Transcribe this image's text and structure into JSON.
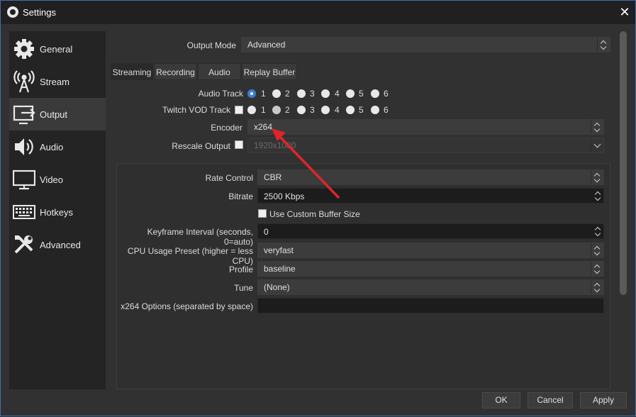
{
  "window": {
    "title": "Settings",
    "close_glyph": "✕"
  },
  "sidebar": {
    "items": [
      {
        "label": "General",
        "icon": "gear-icon"
      },
      {
        "label": "Stream",
        "icon": "broadcast-icon"
      },
      {
        "label": "Output",
        "icon": "output-icon",
        "active": true
      },
      {
        "label": "Audio",
        "icon": "speaker-icon"
      },
      {
        "label": "Video",
        "icon": "monitor-icon"
      },
      {
        "label": "Hotkeys",
        "icon": "keyboard-icon"
      },
      {
        "label": "Advanced",
        "icon": "tools-icon"
      }
    ]
  },
  "output": {
    "mode_label": "Output Mode",
    "mode_value": "Advanced",
    "tabs": [
      "Streaming",
      "Recording",
      "Audio",
      "Replay Buffer"
    ],
    "active_tab": "Streaming",
    "audio_track_label": "Audio Track",
    "twitch_vod_label": "Twitch VOD Track",
    "track_numbers": [
      "1",
      "2",
      "3",
      "4",
      "5",
      "6"
    ],
    "encoder_label": "Encoder",
    "encoder_value": "x264",
    "rescale_label": "Rescale Output",
    "rescale_value": "1920x1080"
  },
  "encoder_settings": {
    "rate_control_label": "Rate Control",
    "rate_control_value": "CBR",
    "bitrate_label": "Bitrate",
    "bitrate_value": "2500 Kbps",
    "custom_buffer_label": "Use Custom Buffer Size",
    "keyframe_label": "Keyframe Interval (seconds, 0=auto)",
    "keyframe_value": "0",
    "cpu_preset_label": "CPU Usage Preset (higher = less CPU)",
    "cpu_preset_value": "veryfast",
    "profile_label": "Profile",
    "profile_value": "baseline",
    "tune_label": "Tune",
    "tune_value": "(None)",
    "options_label": "x264 Options (separated by space)",
    "options_value": ""
  },
  "buttons": {
    "ok": "OK",
    "cancel": "Cancel",
    "apply": "Apply"
  },
  "colors": {
    "accent": "#3b7ed4",
    "annotation_arrow": "#e0242b"
  }
}
